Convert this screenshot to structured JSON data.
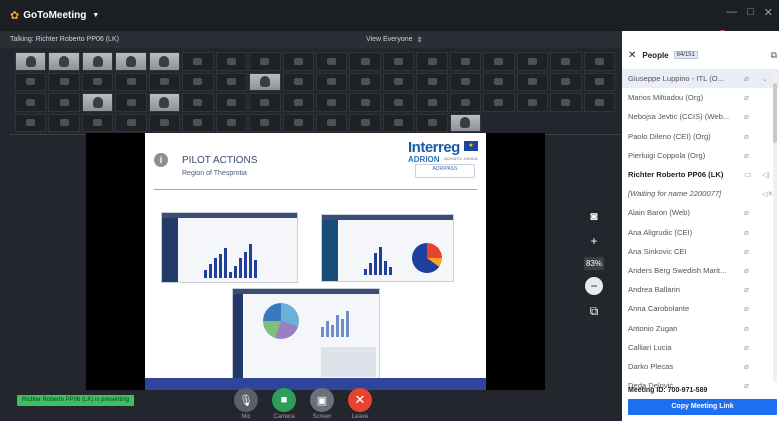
{
  "app": {
    "name": "GoToMeeting",
    "window_controls": [
      "—",
      "□",
      "✕"
    ]
  },
  "infobar": {
    "talking": "Talking: Richter Roberto PP06 (LK)",
    "view": "View Everyone"
  },
  "panel_top": {
    "people_count": "64"
  },
  "panel": {
    "title": "People",
    "count": "64/151",
    "people": [
      {
        "name": "Giuseppe Luppino - ITL (O...",
        "selected": true
      },
      {
        "name": "Marios Miltiadou (Org)"
      },
      {
        "name": "Nebojsa Jevtic (CCIS) (Web..."
      },
      {
        "name": "Paolo Dileno (CEI) (Org)"
      },
      {
        "name": "Pierluigi Coppola (Org)"
      },
      {
        "name": "Richter Roberto PP06 (LK)",
        "bold": true
      },
      {
        "name": "[Waiting for name 2200077]",
        "italic": true
      },
      {
        "name": "Alain Baron (Web)"
      },
      {
        "name": "Ana Aligrudic (CEI)"
      },
      {
        "name": "Ana Sinkovic CEI"
      },
      {
        "name": "Anders Berg Swedish Marit..."
      },
      {
        "name": "Andrea Ballarin"
      },
      {
        "name": "Anna Carobolante"
      },
      {
        "name": "Antonio Zugan"
      },
      {
        "name": "Calliari Lucia"
      },
      {
        "name": "Darko Plecas"
      },
      {
        "name": "Deda Delović"
      }
    ],
    "meeting_id": "Meeting ID: 700-971-589",
    "copy_link": "Copy Meeting Link"
  },
  "slide": {
    "title": "PILOT ACTIONS",
    "subtitle": "Region of Thesprotia",
    "brand_interreg": "Interreg",
    "brand_adrion": "ADRION",
    "brand_sub": "ADRIATIC-IONIAN",
    "brand_project": "ADRIPASS"
  },
  "tools": {
    "zoom": "83%"
  },
  "presenting_banner": "Richter Roberto PP06 (LK) is presenting",
  "controls": {
    "mic": "Mic",
    "camera": "Camera",
    "screen": "Screen",
    "leave": "Leave"
  },
  "colors": {
    "accent_blue": "#1d6ff2",
    "leave_red": "#e8432f",
    "camera_green": "#2e9e5b",
    "presenting_green": "#3fbf63",
    "brand_orange": "#f5a623"
  }
}
